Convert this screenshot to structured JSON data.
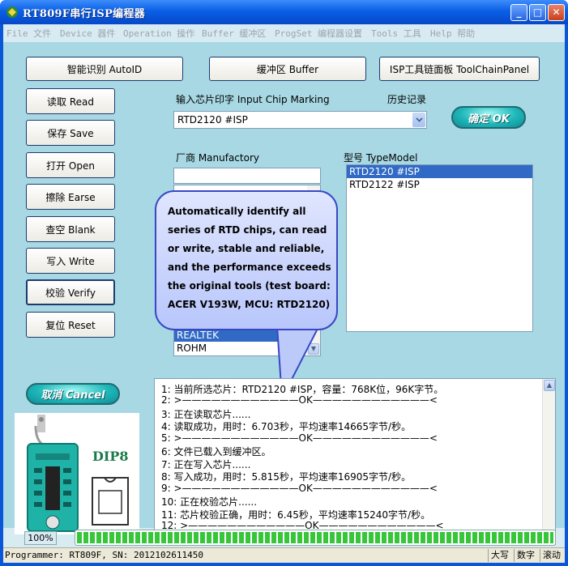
{
  "window": {
    "title": "RT809F串行ISP编程器",
    "controls": {
      "minimize": "_",
      "maximize": "□",
      "close": "✕"
    }
  },
  "menu": [
    "File 文件",
    "Device 器件",
    "Operation 操作",
    "Buffer 缓冲区",
    "ProgSet 编程器设置",
    "Tools 工具",
    "Help 帮助"
  ],
  "toolbar": {
    "autoid": "智能识别 AutoID",
    "buffer": "缓冲区 Buffer",
    "toolchain": "ISP工具链面板  ToolChainPanel"
  },
  "side_buttons": {
    "read": "读取 Read",
    "save": "保存 Save",
    "open": "打开 Open",
    "erase": "擦除 Earse",
    "blank": "查空 Blank",
    "write": "写入 Write",
    "verify": "校验 Verify",
    "reset": "复位 Reset"
  },
  "chip_marking": {
    "label": "输入芯片印字 Input Chip Marking",
    "history_label": "历史记录",
    "value": "RTD2120 #ISP"
  },
  "ok_button": "确定 OK",
  "cancel_button": "取消 Cancel",
  "manufactory": {
    "label": "厂商 Manufactory",
    "visible_items": [
      {
        "text": "REALTEK",
        "selected": true
      },
      {
        "text": "ROHM",
        "selected": false
      }
    ]
  },
  "typemodel": {
    "label": "型号 TypeModel",
    "items": [
      {
        "text": "RTD2120 #ISP",
        "selected": true
      },
      {
        "text": "RTD2122 #ISP",
        "selected": false
      }
    ]
  },
  "callout": "Automatically identify all series of RTD chips, can read or write, stable and reliable, and the performance exceeds the original tools (test board: ACER V193W, MCU: RTD2120)",
  "log": [
    "1:  当前所选芯片：RTD2120 #ISP，容量：768K位，96K字节。",
    "2:  >————————————OK————————————<",
    "3:  正在读取芯片......",
    "4:  读取成功，用时：6.703秒，平均速率14665字节/秒。",
    "5:  >————————————OK————————————<",
    "6:  文件已载入到缓冲区。",
    "7:  正在写入芯片......",
    "8:  写入成功，用时：5.815秒，平均速率16905字节/秒。",
    "9:  >————————————OK————————————<",
    "10:  正在校验芯片......",
    "11:  芯片校验正确，用时：6.45秒，平均速率15240字节/秒。",
    "12:  >————————————OK————————————<"
  ],
  "chip_image_label": "DIP8",
  "progress": {
    "percent_text": "100%",
    "fraction": 1.0
  },
  "statusbar": {
    "programmer": "Programmer: RT809F, SN: 2012102611450",
    "caps": "大写",
    "num": "数字",
    "scroll": "滚动"
  },
  "colors": {
    "title_blue": "#0a5fe6",
    "panel": "#a8d8e4",
    "pill_teal": "#1fb7b9",
    "progress_green": "#37c53a",
    "selection": "#316ac5"
  }
}
